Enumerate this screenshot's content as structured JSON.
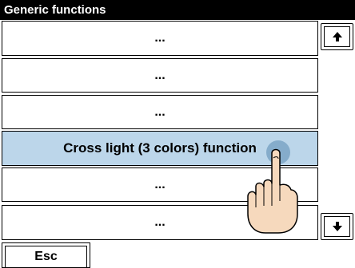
{
  "window": {
    "title": "Generic functions"
  },
  "list": {
    "items": [
      {
        "label": "..."
      },
      {
        "label": "..."
      },
      {
        "label": "..."
      },
      {
        "label": "Cross light (3 colors) function",
        "selected": true
      },
      {
        "label": "..."
      },
      {
        "label": "..."
      }
    ]
  },
  "scroll": {
    "up_icon": "arrow-up-icon",
    "down_icon": "arrow-down-icon"
  },
  "buttons": {
    "esc_label": "Esc"
  },
  "colors": {
    "selected_bg": "#bcd6ea",
    "touch_point": "#7ea7c8",
    "hand_skin": "#f6d9bd"
  }
}
